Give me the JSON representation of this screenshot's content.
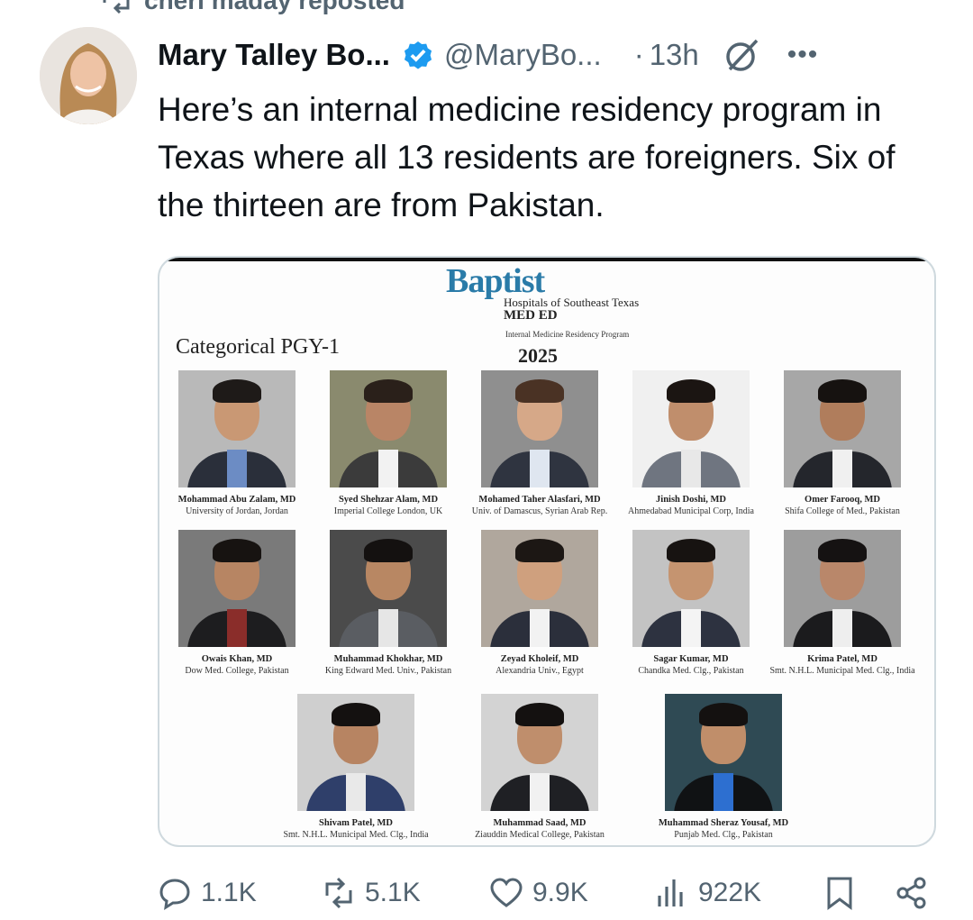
{
  "repost": {
    "label": "cheri maday reposted"
  },
  "tweet": {
    "author_name": "Mary Talley Bo...",
    "handle": "@MaryBo...",
    "separator": "·",
    "time": "13h",
    "more": "•••",
    "text": "Here’s an internal medicine residency program in Texas where all 13 residents are foreigners. Six of the thirteen are from Pakistan."
  },
  "media": {
    "logo_brand": "Baptist",
    "logo_hospitals": "Hospitals of Southeast Texas",
    "logo_meded": "MED ED",
    "logo_program": "Internal Medicine Residency Program",
    "heading": "Categorical PGY-1",
    "year": "2025",
    "people": [
      {
        "name": "Mohammad Abu Zalam, MD",
        "school": "University of Jordan, Jordan"
      },
      {
        "name": "Syed Shehzar Alam, MD",
        "school": "Imperial College London, UK"
      },
      {
        "name": "Mohamed Taher Alasfari, MD",
        "school": "Univ. of Damascus, Syrian Arab Rep."
      },
      {
        "name": "Jinish Doshi, MD",
        "school": "Ahmedabad Municipal Corp, India"
      },
      {
        "name": "Omer Farooq, MD",
        "school": "Shifa College of Med., Pakistan"
      },
      {
        "name": "Owais Khan, MD",
        "school": "Dow Med. College, Pakistan"
      },
      {
        "name": "Muhammad Khokhar, MD",
        "school": "King Edward Med. Univ., Pakistan"
      },
      {
        "name": "Zeyad Kholeif, MD",
        "school": "Alexandria Univ., Egypt"
      },
      {
        "name": "Sagar Kumar, MD",
        "school": "Chandka Med. Clg., Pakistan"
      },
      {
        "name": "Krima Patel, MD",
        "school": "Smt. N.H.L. Municipal Med. Clg., India"
      },
      {
        "name": "Shivam Patel, MD",
        "school": "Smt. N.H.L. Municipal Med. Clg., India"
      },
      {
        "name": "Muhammad Saad, MD",
        "school": "Ziauddin Medical College, Pakistan"
      },
      {
        "name": "Muhammad Sheraz Yousaf, MD",
        "school": "Punjab Med. Clg., Pakistan"
      }
    ]
  },
  "actions": {
    "replies": "1.1K",
    "reposts": "5.1K",
    "likes": "9.9K",
    "views": "922K"
  },
  "colors": {
    "verified": "#1d9bf0",
    "muted": "#536471",
    "baptist_blue": "#2a7ba8"
  }
}
